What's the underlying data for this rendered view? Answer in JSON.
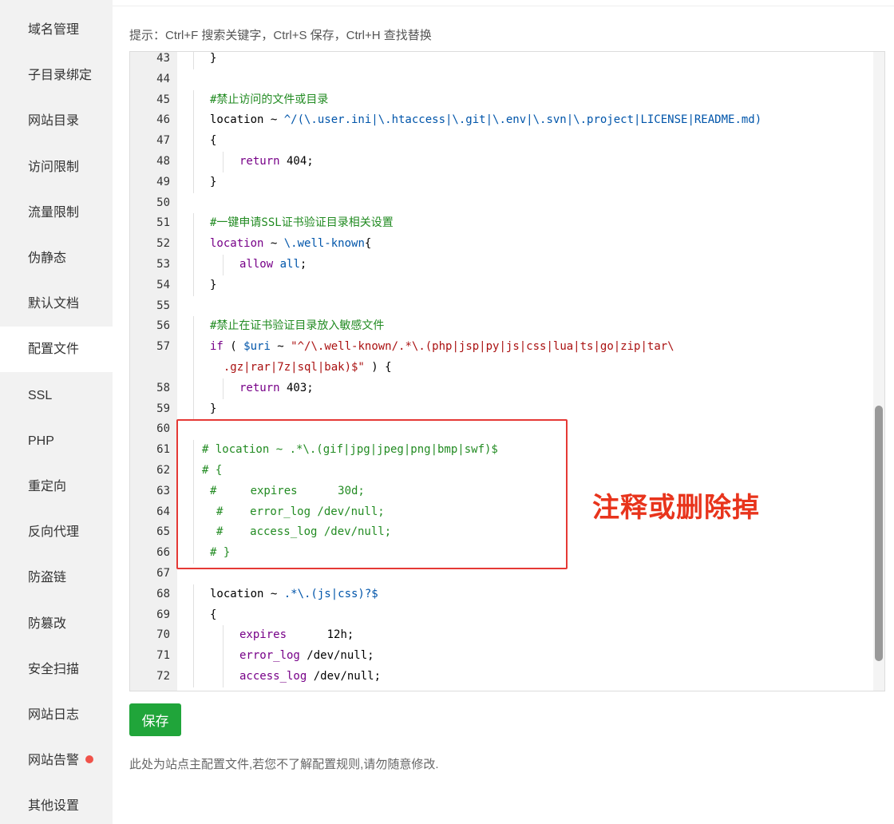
{
  "sidebar": {
    "items": [
      {
        "label": "域名管理"
      },
      {
        "label": "子目录绑定"
      },
      {
        "label": "网站目录"
      },
      {
        "label": "访问限制"
      },
      {
        "label": "流量限制"
      },
      {
        "label": "伪静态"
      },
      {
        "label": "默认文档"
      },
      {
        "label": "配置文件",
        "active": true
      },
      {
        "label": "SSL"
      },
      {
        "label": "PHP"
      },
      {
        "label": "重定向"
      },
      {
        "label": "反向代理"
      },
      {
        "label": "防盗链"
      },
      {
        "label": "防篡改"
      },
      {
        "label": "安全扫描"
      },
      {
        "label": "网站日志"
      },
      {
        "label": "网站告警",
        "badge": true
      },
      {
        "label": "其他设置"
      }
    ]
  },
  "hint": "提示：Ctrl+F 搜索关键字，Ctrl+S 保存，Ctrl+H 查找替换",
  "editor": {
    "lines": [
      {
        "n": "43",
        "indent": 1,
        "tokens": [
          [
            "plain",
            "}"
          ]
        ]
      },
      {
        "n": "44",
        "indent": 0,
        "tokens": []
      },
      {
        "n": "45",
        "indent": 1,
        "tokens": [
          [
            "cm",
            "#禁止访问的文件或目录"
          ]
        ]
      },
      {
        "n": "46",
        "indent": 1,
        "tokens": [
          [
            "plain",
            "location ~ "
          ],
          [
            "var",
            "^/(\\.user.ini|\\.htaccess|\\.git|\\.env|\\.svn|\\.project|LICENSE|README.md)"
          ]
        ]
      },
      {
        "n": "47",
        "indent": 1,
        "tokens": [
          [
            "plain",
            "{"
          ]
        ]
      },
      {
        "n": "48",
        "indent": 2,
        "tokens": [
          [
            "kw",
            "return"
          ],
          [
            "plain",
            " 404;"
          ]
        ]
      },
      {
        "n": "49",
        "indent": 1,
        "tokens": [
          [
            "plain",
            "}"
          ]
        ]
      },
      {
        "n": "50",
        "indent": 0,
        "tokens": []
      },
      {
        "n": "51",
        "indent": 1,
        "tokens": [
          [
            "cm",
            "#一键申请SSL证书验证目录相关设置"
          ]
        ]
      },
      {
        "n": "52",
        "indent": 1,
        "tokens": [
          [
            "kw",
            "location"
          ],
          [
            "plain",
            " ~ "
          ],
          [
            "var",
            "\\.well-known"
          ],
          [
            "plain",
            "{"
          ]
        ]
      },
      {
        "n": "53",
        "indent": 2,
        "tokens": [
          [
            "kw",
            "allow"
          ],
          [
            "plain",
            " "
          ],
          [
            "var",
            "all"
          ],
          [
            "plain",
            ";"
          ]
        ]
      },
      {
        "n": "54",
        "indent": 1,
        "tokens": [
          [
            "plain",
            "}"
          ]
        ]
      },
      {
        "n": "55",
        "indent": 0,
        "tokens": []
      },
      {
        "n": "56",
        "indent": 1,
        "tokens": [
          [
            "cm",
            "#禁止在证书验证目录放入敏感文件"
          ]
        ]
      },
      {
        "n": "57",
        "indent": 1,
        "tokens": [
          [
            "kw",
            "if"
          ],
          [
            "plain",
            " ( "
          ],
          [
            "var",
            "$uri"
          ],
          [
            "plain",
            " ~ "
          ],
          [
            "str",
            "\"^/\\.well-known/.*\\.(php|jsp|py|js|css|lua|ts|go|zip|tar\\"
          ]
        ]
      },
      {
        "n": "",
        "indent": 1,
        "wrap": true,
        "tokens": [
          [
            "str",
            "  .gz|rar|7z|sql|bak)$\""
          ],
          [
            "plain",
            " ) {"
          ]
        ]
      },
      {
        "n": "58",
        "indent": 2,
        "tokens": [
          [
            "kw",
            "return"
          ],
          [
            "plain",
            " 403;"
          ]
        ]
      },
      {
        "n": "59",
        "indent": 1,
        "tokens": [
          [
            "plain",
            "}"
          ]
        ]
      },
      {
        "n": "60",
        "indent": 0,
        "tokens": []
      },
      {
        "n": "61",
        "indent": 1,
        "shift": -10,
        "tokens": [
          [
            "cm",
            "# location ~ .*\\.(gif|jpg|jpeg|png|bmp|swf)$"
          ]
        ]
      },
      {
        "n": "62",
        "indent": 1,
        "shift": -10,
        "tokens": [
          [
            "cm",
            "# {"
          ]
        ]
      },
      {
        "n": "63",
        "indent": 1,
        "tokens": [
          [
            "cm",
            "#     expires      30d;"
          ]
        ]
      },
      {
        "n": "64",
        "indent": 1,
        "shift": 8,
        "tokens": [
          [
            "cm",
            "#    error_log /dev/null;"
          ]
        ]
      },
      {
        "n": "65",
        "indent": 1,
        "shift": 8,
        "tokens": [
          [
            "cm",
            "#    access_log /dev/null;"
          ]
        ]
      },
      {
        "n": "66",
        "indent": 1,
        "tokens": [
          [
            "cm",
            "# }"
          ]
        ]
      },
      {
        "n": "67",
        "indent": 0,
        "tokens": []
      },
      {
        "n": "68",
        "indent": 1,
        "tokens": [
          [
            "plain",
            "location ~ "
          ],
          [
            "var",
            ".*\\.(js|css)?$"
          ]
        ]
      },
      {
        "n": "69",
        "indent": 1,
        "tokens": [
          [
            "plain",
            "{"
          ]
        ]
      },
      {
        "n": "70",
        "indent": 2,
        "tokens": [
          [
            "kw",
            "expires"
          ],
          [
            "plain",
            "      12h;"
          ]
        ]
      },
      {
        "n": "71",
        "indent": 2,
        "tokens": [
          [
            "kw",
            "error_log"
          ],
          [
            "plain",
            " /dev/null;"
          ]
        ]
      },
      {
        "n": "72",
        "indent": 2,
        "tokens": [
          [
            "kw",
            "access_log"
          ],
          [
            "plain",
            " /dev/null;"
          ]
        ]
      }
    ]
  },
  "annotation": "注释或删除掉",
  "save_button": "保存",
  "note": "此处为站点主配置文件,若您不了解配置规则,请勿随意修改.",
  "colors": {
    "accent": "#20a53a",
    "annotation_red": "#e53935",
    "badge_red": "#f0524a"
  }
}
